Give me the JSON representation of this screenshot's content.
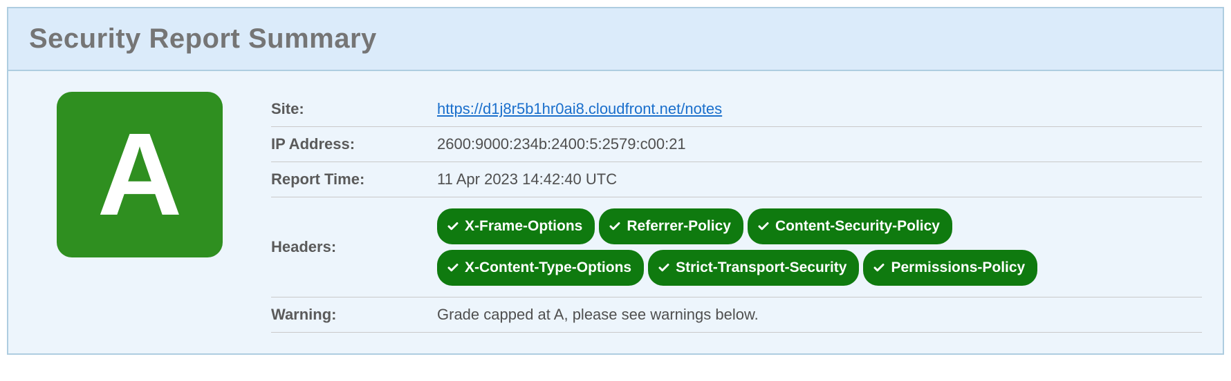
{
  "title": "Security Report Summary",
  "grade": "A",
  "rows": {
    "site_label": "Site:",
    "site_value": "https://d1j8r5b1hr0ai8.cloudfront.net/notes",
    "ip_label": "IP Address:",
    "ip_value": "2600:9000:234b:2400:5:2579:c00:21",
    "time_label": "Report Time:",
    "time_value": "11 Apr 2023 14:42:40 UTC",
    "headers_label": "Headers:",
    "warning_label": "Warning:",
    "warning_value": "Grade capped at A, please see warnings below."
  },
  "headers_badges": [
    "X-Frame-Options",
    "Referrer-Policy",
    "Content-Security-Policy",
    "X-Content-Type-Options",
    "Strict-Transport-Security",
    "Permissions-Policy"
  ],
  "colors": {
    "grade_bg": "#2f8f20",
    "badge_bg": "#0f7a0f",
    "link": "#1a6fcc"
  }
}
